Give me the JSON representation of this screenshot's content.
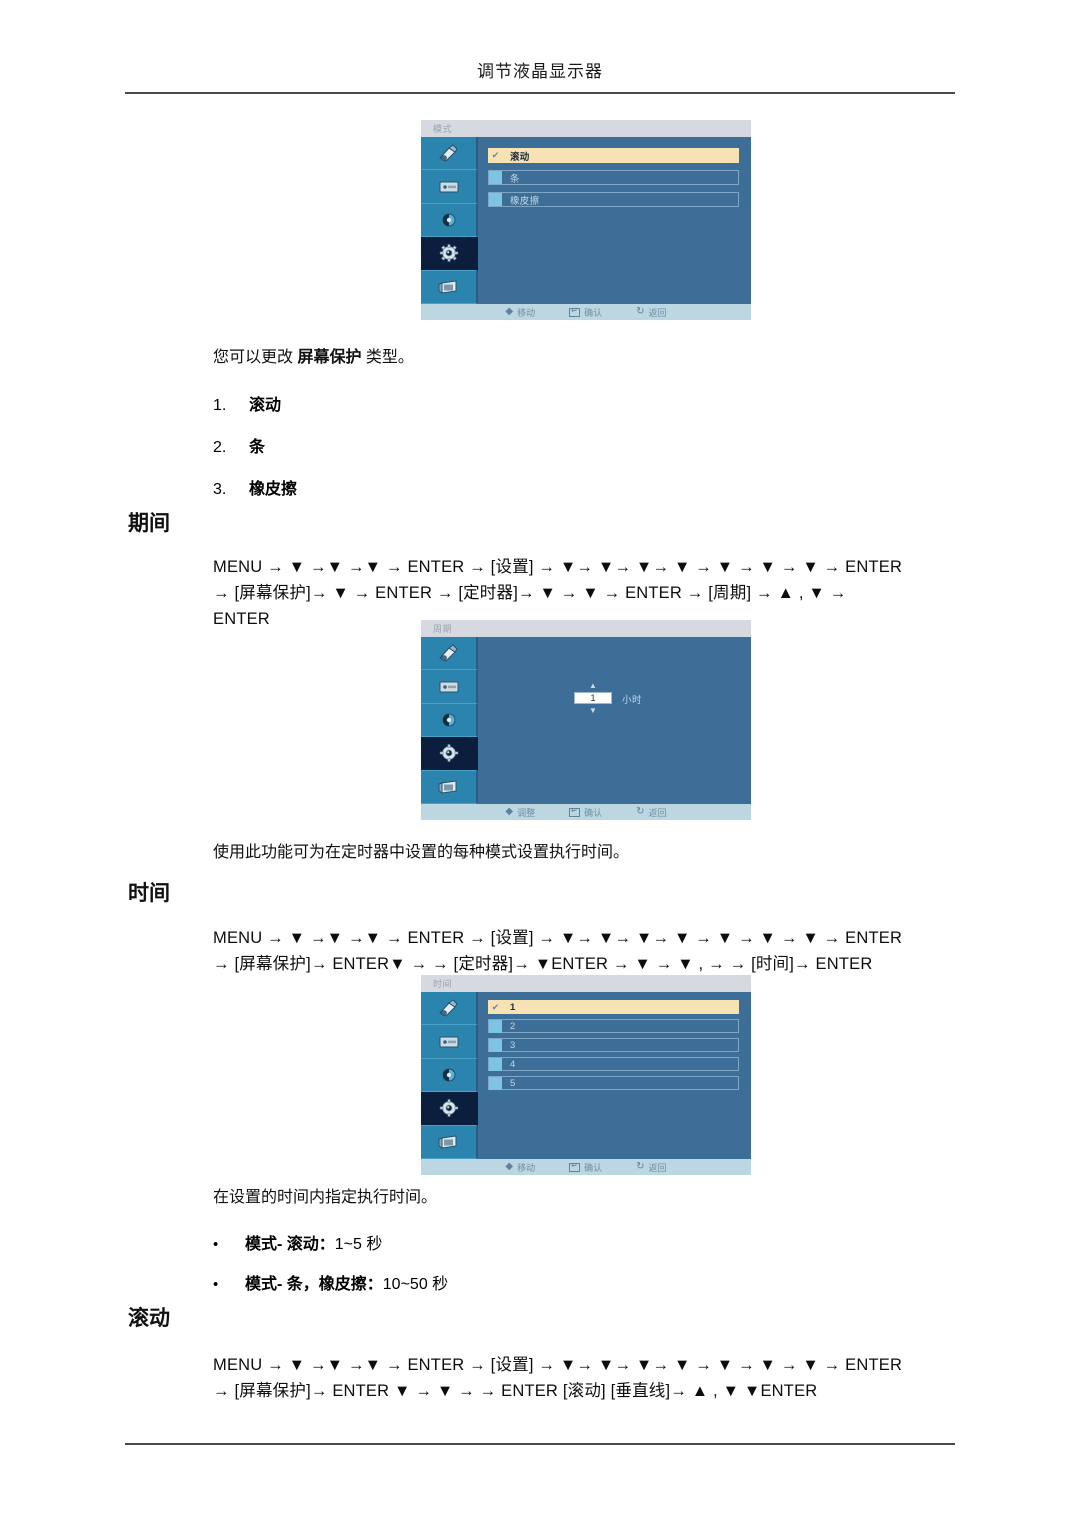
{
  "header": {
    "title": "调节液晶显示器"
  },
  "osd_mode": {
    "title": "模式",
    "rows": [
      {
        "label": "滚动",
        "selected": true,
        "mark": "✔"
      },
      {
        "label": "条",
        "selected": false,
        "mark": ""
      },
      {
        "label": "橡皮擦",
        "selected": false,
        "mark": ""
      }
    ],
    "footer": [
      {
        "icon": "updown-diamond-icon",
        "label": "移动"
      },
      {
        "icon": "enter-key-icon",
        "label": "确认"
      },
      {
        "icon": "return-arrow-icon",
        "label": "返回"
      }
    ],
    "sidebar_icons": [
      "brush-icon",
      "display-icon",
      "sound-icon",
      "gear-icon",
      "screen-icon"
    ],
    "selected_sidebar_index": 3
  },
  "intro": {
    "line": "您可以更改 屏幕保护 类型。",
    "line_pre": "您可以更改 ",
    "line_bold": "屏幕保护",
    "line_post": " 类型。",
    "items": [
      {
        "num": "1.",
        "label": "滚动"
      },
      {
        "num": "2.",
        "label": "条"
      },
      {
        "num": "3.",
        "label": "橡皮擦"
      }
    ]
  },
  "section_duration": {
    "heading": "期间",
    "keys_line1": "MENU →  ▼  →▼  →▼  →  ENTER  →  [设置]  →  ▼→  ▼→  ▼→  ▼  →  ▼  →  ▼  →  ▼  →  ENTER",
    "keys_line2": "→  [屏幕保护]→  ▼  →  ENTER  →  [定时器]→  ▼  →  ▼  →  ENTER  →  [周期]  →  ▲ ,  ▼  →",
    "keys_line3": "ENTER",
    "caption": "使用此功能可为在定时器中设置的每种模式设置执行时间。"
  },
  "osd_cycle": {
    "title": "周期",
    "spinner": {
      "up_icon": "triangle-up-icon",
      "value": "1",
      "down_icon": "triangle-down-icon",
      "unit": "小时"
    },
    "footer": [
      {
        "icon": "updown-diamond-icon",
        "label": "调整"
      },
      {
        "icon": "enter-key-icon",
        "label": "确认"
      },
      {
        "icon": "return-arrow-icon",
        "label": "返回"
      }
    ],
    "sidebar_icons": [
      "brush-icon",
      "display-icon",
      "sound-icon",
      "gear-icon",
      "screen-icon"
    ],
    "selected_sidebar_index": 3
  },
  "section_time": {
    "heading": "时间",
    "keys_line1": "MENU →  ▼  →▼  →▼  →  ENTER  →  [设置]  →  ▼→  ▼→  ▼→  ▼  →  ▼  →  ▼  →  ▼  →  ENTER",
    "keys_line2": "→  [屏幕保护]→  ENTER▼  →  →  [定时器]→  ▼ENTER  →  ▼  →  ▼ ,  →  →  [时间]→  ENTER",
    "caption": "在设置的时间内指定执行时间。",
    "bullets": [
      {
        "dot": "•",
        "text": "模式- 滚动：",
        "value": "1~5 秒"
      },
      {
        "dot": "•",
        "text": "模式- 条，橡皮擦：",
        "value": "10~50 秒"
      }
    ]
  },
  "osd_time": {
    "title": "时间",
    "rows": [
      {
        "label": "1",
        "selected": true,
        "mark": "✔"
      },
      {
        "label": "2",
        "selected": false,
        "mark": ""
      },
      {
        "label": "3",
        "selected": false,
        "mark": ""
      },
      {
        "label": "4",
        "selected": false,
        "mark": ""
      },
      {
        "label": "5",
        "selected": false,
        "mark": ""
      }
    ],
    "footer": [
      {
        "icon": "updown-diamond-icon",
        "label": "移动"
      },
      {
        "icon": "enter-key-icon",
        "label": "确认"
      },
      {
        "icon": "return-arrow-icon",
        "label": "返回"
      }
    ],
    "sidebar_icons": [
      "brush-icon",
      "display-icon",
      "sound-icon",
      "gear-icon",
      "screen-icon"
    ],
    "selected_sidebar_index": 3
  },
  "section_scroll": {
    "heading": "滚动",
    "keys_line1": "MENU →  ▼  →▼  →▼  →  ENTER  →  [设置]  →  ▼→  ▼→  ▼→  ▼  →  ▼  →  ▼  →  ▼  →  ENTER",
    "keys_line2": "→  [屏幕保护]→  ENTER ▼  →  ▼  →  →  ENTER [滚动] [垂直线]→  ▲ ,  ▼ ▼ENTER"
  },
  "colors": {
    "osd_panel": "#3d6e97",
    "osd_sidebar": "#2b84ad",
    "osd_selected_row": "#f7e2b4",
    "osd_titlebar": "#d6dae0",
    "osd_footer": "#bcd6e2",
    "rule": "#4a4a4a"
  }
}
